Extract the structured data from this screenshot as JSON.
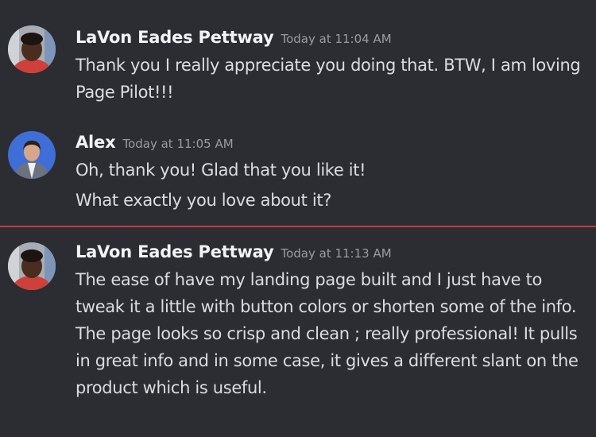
{
  "theme": {
    "background": "#2c2d32",
    "new_messages_divider": "#c23b3f"
  },
  "messages": [
    {
      "author": "LaVon Eades Pettway",
      "timestamp": "Today at 11:04 AM",
      "avatar_icon": "user-avatar-photo",
      "lines": [
        "Thank you I really appreciate you doing that. BTW, I am loving Page Pilot!!!"
      ]
    },
    {
      "author": "Alex",
      "timestamp": "Today at 11:05 AM",
      "avatar_icon": "user-avatar-photo",
      "lines": [
        "Oh, thank you! Glad that you like it!",
        "What exactly you love about it?"
      ]
    },
    {
      "author": "LaVon Eades Pettway",
      "timestamp": "Today at 11:13 AM",
      "avatar_icon": "user-avatar-photo",
      "lines": [
        "The ease of have my landing page built and I just have to tweak it a little with button colors or shorten some of the info. The page looks so crisp and clean ; really professional! It pulls in great info and in some case, it gives a different slant on the product which is useful."
      ]
    }
  ]
}
